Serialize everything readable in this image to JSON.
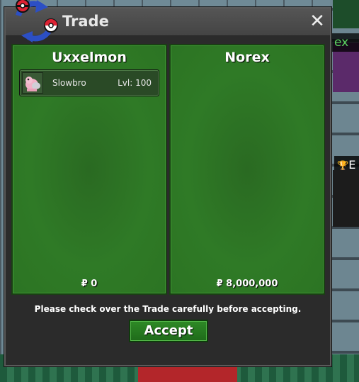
{
  "window": {
    "title": "Trade",
    "close_symbol": "✕"
  },
  "left_party": {
    "name": "Uxxelmon",
    "money": "₽ 0",
    "items": [
      {
        "name": "Slowbro",
        "level": "Lvl: 100",
        "icon": "slowbro-sprite-icon"
      }
    ]
  },
  "right_party": {
    "name": "Norex",
    "money": "₽ 8,000,000"
  },
  "notice": "Please check over the Trade carefully before accepting.",
  "accept_label": "Accept",
  "background": {
    "nametag_partial": "ex",
    "badge_partial": "E"
  },
  "colors": {
    "panel_green": "#2f7a26",
    "accept_green": "#2e8a26",
    "window_bg": "#2b2b2b"
  }
}
